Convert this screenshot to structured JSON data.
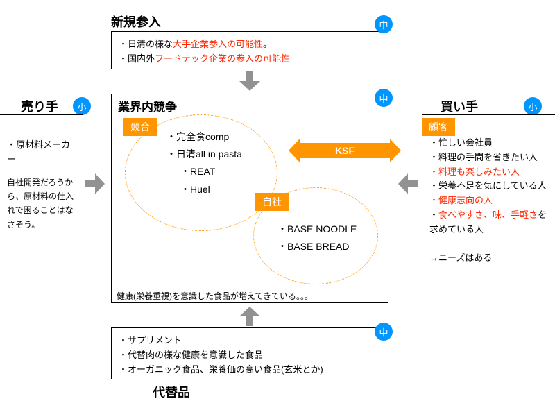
{
  "newEntrants": {
    "title": "新規参入",
    "badge": "中",
    "line1_pre": "・日清の様な",
    "line1_red": "大手企業参入の可能性",
    "line1_post": "。",
    "line2_pre": "・国内外",
    "line2_red": "フードテック企業の参入の可能性"
  },
  "suppliers": {
    "title": "売り手",
    "badge": "小",
    "line1": "・原材料メーカー",
    "note": "自社開発だろうから、原材料の仕入れで困ることはなさそう。"
  },
  "buyers": {
    "title": "買い手",
    "badge": "小",
    "tag": "顧客",
    "items": {
      "i1": "・忙しい会社員",
      "i2": "・料理の手間を省きたい人",
      "i3_red": "・料理も楽しみたい人",
      "i4": "・栄養不足を気にしている人",
      "i5_red": "・健康志向の人",
      "i6_pre": "・",
      "i6_red": "食べやすさ、味、手軽さ",
      "i6_post": "を求めている人"
    },
    "conclusion": "→ニーズはある"
  },
  "substitutes": {
    "title": "代替品",
    "badge": "中",
    "i1": "・サプリメント",
    "i2": "・代替肉の様な健康を意識した食品",
    "i3": "・オーガニック食品、栄養価の高い食品(玄米とか)"
  },
  "rivalry": {
    "title": "業界内競争",
    "badge": "中",
    "competitorsTag": "競合",
    "competitors": {
      "c1": "・完全食comp",
      "c2": "・日清all in pasta",
      "c3": "・REAT",
      "c4": "・Huel"
    },
    "ownTag": "自社",
    "own": {
      "o1": "・BASE NOODLE",
      "o2": "・BASE BREAD"
    },
    "footnote": "健康(栄養重視)を意識した食品が増えてきている。。。"
  },
  "ksf": {
    "label": "KSF"
  }
}
